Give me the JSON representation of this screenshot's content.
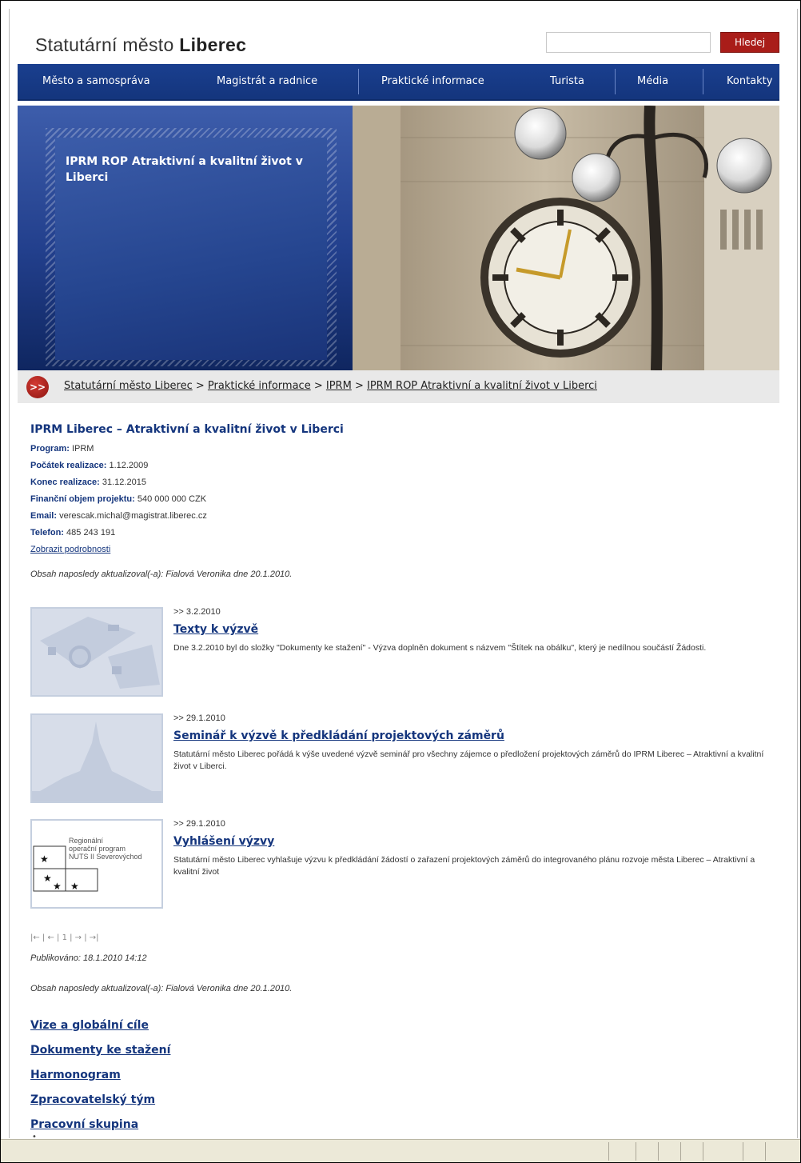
{
  "header": {
    "site_title_prefix": "Statutární město ",
    "site_title_bold": "Liberec",
    "search_placeholder": "",
    "search_button": "Hledej"
  },
  "nav": {
    "items": [
      {
        "label": "Město a samospráva"
      },
      {
        "label": "Magistrát a radnice"
      },
      {
        "label": "Praktické informace"
      },
      {
        "label": "Turista"
      },
      {
        "label": "Média"
      },
      {
        "label": "Kontakty"
      }
    ]
  },
  "banner": {
    "title": "IPRM ROP Atraktivní a kvalitní život v Liberci"
  },
  "breadcrumb": {
    "icon": ">>",
    "items": [
      "Statutární město Liberec",
      "Praktické informace",
      "IPRM",
      "IPRM ROP Atraktivní a kvalitní život v Liberci"
    ],
    "separator": " > "
  },
  "project": {
    "title": "IPRM Liberec – Atraktivní a kvalitní život v Liberci",
    "fields": [
      {
        "label": "Program:",
        "value": "IPRM"
      },
      {
        "label": "Počátek realizace:",
        "value": "1.12.2009"
      },
      {
        "label": "Konec realizace:",
        "value": "31.12.2015"
      },
      {
        "label": "Finanční objem projektu:",
        "value": "540 000 000 CZK"
      },
      {
        "label": "Email:",
        "value": "verescak.michal@magistrat.liberec.cz"
      },
      {
        "label": "Telefon:",
        "value": "485 243 191"
      }
    ],
    "more_link": "Zobrazit podrobnosti",
    "last_updated": "Obsah naposledy aktualizoval(-a): Fialová Veronika dne 20.1.2010."
  },
  "news": [
    {
      "date": ">> 3.2.2010",
      "title": "Texty k výzvě",
      "text": "Dne 3.2.2010 byl do složky \"Dokumenty ke stažení\" - Výzva doplněn dokument s názvem \"Štítek na obálku\", který je nedílnou součástí Žádosti."
    },
    {
      "date": ">> 29.1.2010",
      "title": "Seminář k výzvě k předkládání projektových záměrů",
      "text": "Statutární město Liberec pořádá k výše uvedené výzvě seminář pro všechny zájemce o předložení projektových záměrů do IPRM Liberec – Atraktivní a kvalitní život v Liberci."
    },
    {
      "date": ">> 29.1.2010",
      "title": "Vyhlášení výzvy",
      "text": "Statutární město Liberec vyhlašuje výzvu k předkládání žádostí o zařazení projektových záměrů do integrovaného plánu rozvoje města Liberec – Atraktivní a kvalitní život",
      "thumb_lines": [
        "Regionální",
        "operační program",
        "NUTS II Severovýchod"
      ]
    }
  ],
  "pager": "|← | ← | 1 | → | →|",
  "published": "Publikováno: 18.1.2010 14:12",
  "last_updated_2": "Obsah naposledy aktualizoval(-a): Fialová Veronika dne 20.1.2010.",
  "links": [
    "Vize a globální cíle",
    "Dokumenty ke stažení",
    "Harmonogram",
    "Zpracovatelský tým",
    "Pracovní skupina"
  ],
  "colors": {
    "nav_blue": "#14357d",
    "accent_red": "#a91d19",
    "link_blue": "#14357d"
  }
}
